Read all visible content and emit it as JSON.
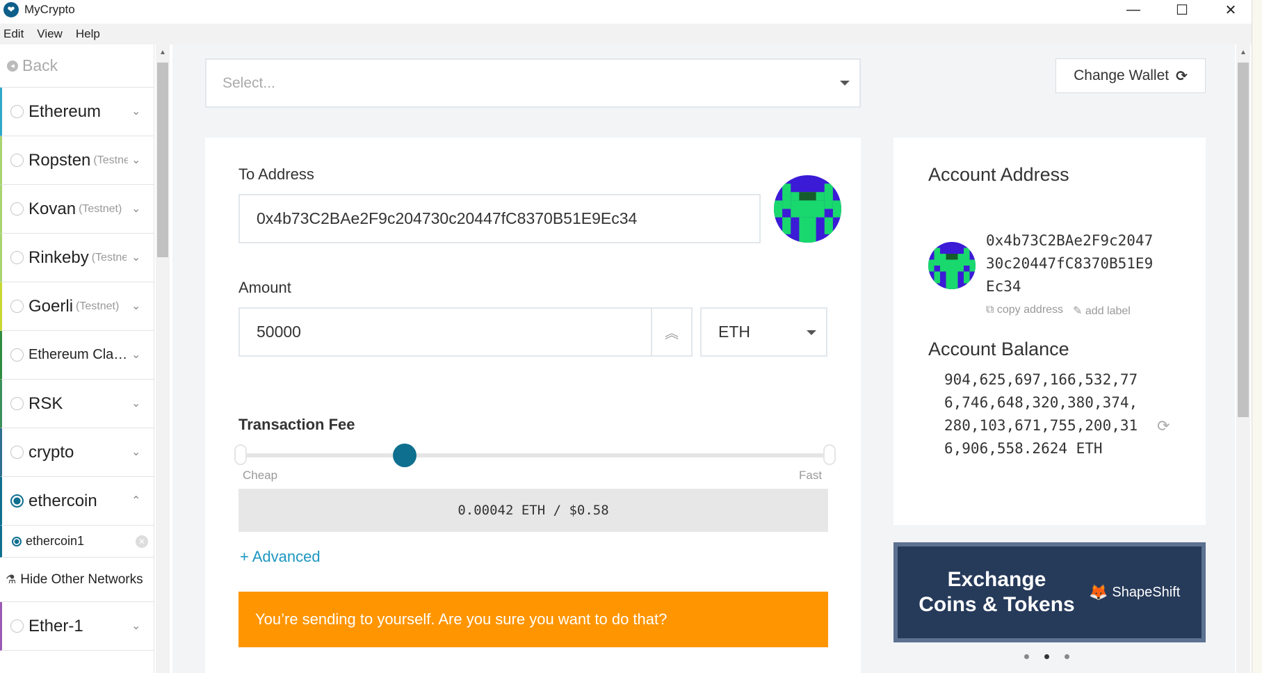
{
  "window": {
    "title": "MyCrypto",
    "logo_glyph": "❤",
    "minimize": "—",
    "maximize": "☐",
    "close": "✕"
  },
  "menu": {
    "items": [
      "Edit",
      "View",
      "Help"
    ]
  },
  "sidebar": {
    "back_label": "Back",
    "networks": [
      {
        "name": "Ethereum",
        "tag": "",
        "color": "#2ea8c9"
      },
      {
        "name": "Ropsten",
        "tag": "(Testnet)",
        "color": "#a8d46f"
      },
      {
        "name": "Kovan",
        "tag": "(Testnet)",
        "color": "#a8d46f"
      },
      {
        "name": "Rinkeby",
        "tag": "(Testnet)",
        "color": "#a8d46f"
      },
      {
        "name": "Goerli",
        "tag": "(Testnet)",
        "color": "#c8d830"
      },
      {
        "name": "Ethereum Cla…",
        "tag": "",
        "color": "#2e8b3f"
      },
      {
        "name": "RSK",
        "tag": "",
        "color": "#3a8f5a"
      },
      {
        "name": "crypto",
        "tag": "",
        "color": "#2f6f8f"
      },
      {
        "name": "ethercoin",
        "tag": "",
        "color": "#0e6f8f"
      }
    ],
    "selected_node": "ethercoin1",
    "hide_other": "Hide Other Networks",
    "extra_network": {
      "name": "Ether-1",
      "tag": "",
      "color": "#9b59b6"
    },
    "chevron_down": "⌄",
    "chevron_up": "⌃"
  },
  "node_select": {
    "placeholder": "Select..."
  },
  "change_wallet": {
    "label": "Change Wallet",
    "icon": "⟳"
  },
  "form": {
    "to_address_label": "To Address",
    "to_address_value": "0x4b73C2BAe2F9c204730c20447fC8370B51E9Ec34",
    "amount_label": "Amount",
    "amount_value": "50000",
    "amount_spin_icon": "⌃⌃",
    "currency": "ETH",
    "fee_title": "Transaction Fee",
    "fee_slider_position": 0.28,
    "fee_cheap": "Cheap",
    "fee_fast": "Fast",
    "fee_value": "0.00042 ETH / $0.58",
    "advanced": "+ Advanced",
    "warning": "You’re sending to yourself. Are you sure you want to do that?"
  },
  "account": {
    "address_title": "Account Address",
    "address": "0x4b73C2BAe2F9c204730c20447fC8370B51E9Ec34",
    "copy": "copy address",
    "add_label": "add label",
    "balance_title": "Account Balance",
    "balance": "904,625,697,166,532,776,746,648,320,380,374,280,103,671,755,200,316,906,558.2624 ETH",
    "refresh_icon": "⟳"
  },
  "shapeshift": {
    "title": "Exchange Coins & Tokens",
    "brand": "ShapeShift"
  },
  "colors": {
    "accent": "#0e6f8f",
    "warning": "#ff9500",
    "link": "#1c96c0",
    "identicon_bg": "#3b1bd6",
    "identicon_fg": "#19d86d"
  }
}
